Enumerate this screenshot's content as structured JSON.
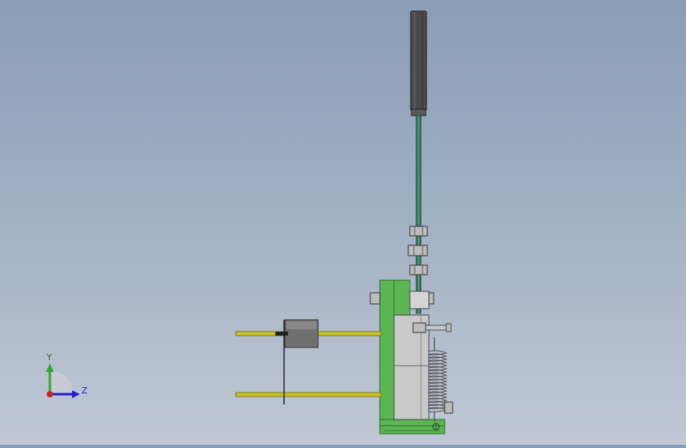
{
  "view": {
    "background_top": "#8a9db6",
    "background_bottom": "#c0c8d5"
  },
  "triad": {
    "y_label": "Y",
    "z_label": "Z",
    "y_color": "#2fa82f",
    "z_color": "#1f1fd0",
    "x_color": "#d01f1f"
  },
  "colors": {
    "plate": "#5bb552",
    "plate_edge": "#2f6a2a",
    "block": "#c9c9c9",
    "rod": "#c8c21e",
    "handle": "#4a4a4a",
    "spring": "#b8b8b8"
  }
}
